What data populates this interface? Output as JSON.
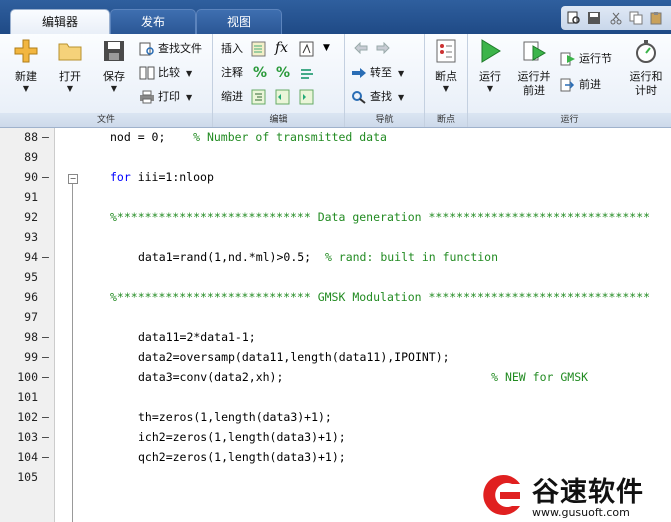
{
  "tabs": [
    {
      "label": "编辑器",
      "active": true
    },
    {
      "label": "发布",
      "active": false
    },
    {
      "label": "视图",
      "active": false
    }
  ],
  "quick_access": [
    "search-doc-icon",
    "save-icon",
    "cut-icon",
    "copy-icon",
    "paste-icon"
  ],
  "ribbon": {
    "file": {
      "label": "文件",
      "new": "新建",
      "open": "打开",
      "save": "保存",
      "find_files": "查找文件",
      "compare": "比较",
      "print": "打印"
    },
    "edit": {
      "label": "编辑",
      "insert": "插入",
      "comment": "注释",
      "indent": "缩进",
      "fx": "fx"
    },
    "navigate": {
      "label": "导航",
      "goto": "转至",
      "find": "查找"
    },
    "breakpoints": {
      "label": "断点",
      "breakpoints": "断点"
    },
    "run": {
      "label": "运行",
      "run": "运行",
      "run_and_advance_1": "运行并",
      "run_and_advance_2": "前进",
      "run_section": "运行节",
      "advance": "前进",
      "run_and_time_1": "运行和",
      "run_and_time_2": "计时"
    }
  },
  "editor": {
    "lines": [
      {
        "no": "88",
        "dash": true,
        "text": "nod = 0;    ",
        "comment": "% Number of transmitted data",
        "indent": 4
      },
      {
        "no": "89",
        "dash": false,
        "text": "",
        "comment": "",
        "indent": 0
      },
      {
        "no": "90",
        "dash": true,
        "keyword": "for",
        "text": " iii=1:nloop",
        "comment": "",
        "indent": 4
      },
      {
        "no": "91",
        "dash": false,
        "text": "",
        "comment": "",
        "indent": 0
      },
      {
        "no": "92",
        "dash": false,
        "text": "",
        "comment": "%**************************** Data generation ********************************",
        "indent": 4
      },
      {
        "no": "93",
        "dash": false,
        "text": "",
        "comment": "",
        "indent": 0
      },
      {
        "no": "94",
        "dash": true,
        "text": "data1=rand(1,nd.*ml)>0.5;  ",
        "comment": "% rand: built in function",
        "indent": 8
      },
      {
        "no": "95",
        "dash": false,
        "text": "",
        "comment": "",
        "indent": 0
      },
      {
        "no": "96",
        "dash": false,
        "text": "",
        "comment": "%**************************** GMSK Modulation ********************************",
        "indent": 4
      },
      {
        "no": "97",
        "dash": false,
        "text": "",
        "comment": "",
        "indent": 0
      },
      {
        "no": "98",
        "dash": true,
        "text": "data11=2*data1-1;",
        "comment": "",
        "indent": 8
      },
      {
        "no": "99",
        "dash": true,
        "text": "data2=oversamp(data11,length(data11),IPOINT);",
        "comment": "",
        "indent": 8
      },
      {
        "no": "100",
        "dash": true,
        "text": "data3=conv(data2,xh);                              ",
        "comment": "% NEW for GMSK",
        "indent": 8
      },
      {
        "no": "101",
        "dash": false,
        "text": "",
        "comment": "",
        "indent": 0
      },
      {
        "no": "102",
        "dash": true,
        "text": "th=zeros(1,length(data3)+1);",
        "comment": "",
        "indent": 8
      },
      {
        "no": "103",
        "dash": true,
        "text": "ich2=zeros(1,length(data3)+1);",
        "comment": "",
        "indent": 8
      },
      {
        "no": "104",
        "dash": true,
        "text": "qch2=zeros(1,length(data3)+1);",
        "comment": "",
        "indent": 8
      },
      {
        "no": "105",
        "dash": false,
        "text": "",
        "comment": "",
        "indent": 0
      }
    ]
  },
  "watermark": {
    "title": "谷速软件",
    "url": "www.gusuoft.com"
  },
  "colors": {
    "keyword": "#0000ff",
    "comment": "#228b22",
    "tabbar": "#1f4a86",
    "watermark_red": "#e02020"
  }
}
